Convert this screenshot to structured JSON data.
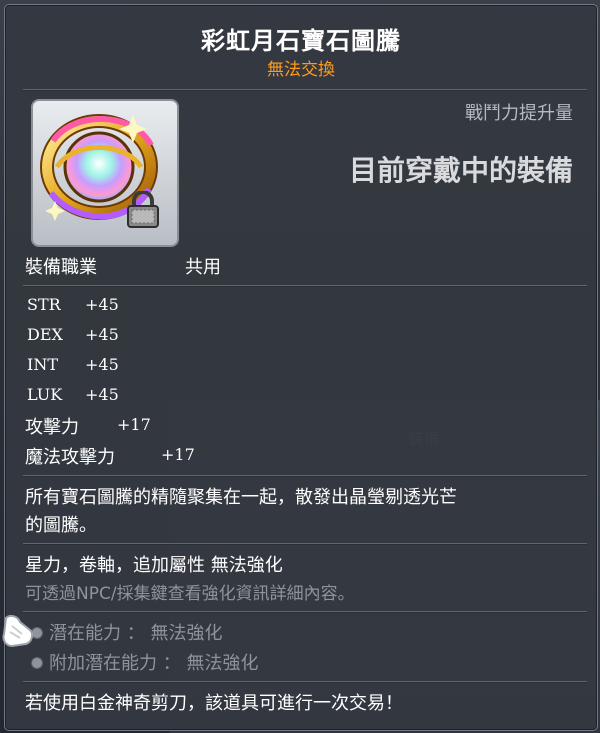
{
  "item": {
    "title": "彩虹月石寶石圖騰",
    "trade_status": "無法交換",
    "icon": "rainbow-moonstone-totem-icon",
    "lock_icon": "lock-icon"
  },
  "compare": {
    "label": "戰鬥力提升量",
    "status": "目前穿戴中的裝備"
  },
  "job": {
    "label": "裝備職業",
    "value": "共用"
  },
  "stats": [
    {
      "name": "STR",
      "value": "+45"
    },
    {
      "name": "DEX",
      "value": "+45"
    },
    {
      "name": "INT",
      "value": "+45"
    },
    {
      "name": "LUK",
      "value": "+45"
    }
  ],
  "attack": {
    "name": "攻擊力",
    "value": "+17"
  },
  "magic_attack": {
    "name": "魔法攻擊力",
    "value": "+17"
  },
  "description": {
    "line1": "所有寶石圖騰的精隨聚集在一起，散發出晶瑩剔透光芒",
    "line2": "的圖騰。"
  },
  "enhance": {
    "line": "星力，卷軸，追加屬性 無法強化",
    "hint": "可透過NPC/採集鍵查看強化資訊詳細內容。"
  },
  "potential": {
    "label": "潛在能力 ： 無法強化",
    "additional_label": "附加潛在能力 ： 無法強化"
  },
  "footer": "若使用白金神奇剪刀，該道具可進行一次交易！",
  "background": {
    "tab_label": "裝備"
  },
  "colors": {
    "title": "#ffffff",
    "trade_status": "#ff9b1a",
    "panel_bg": "#343840",
    "muted_text": "#8e949c"
  }
}
